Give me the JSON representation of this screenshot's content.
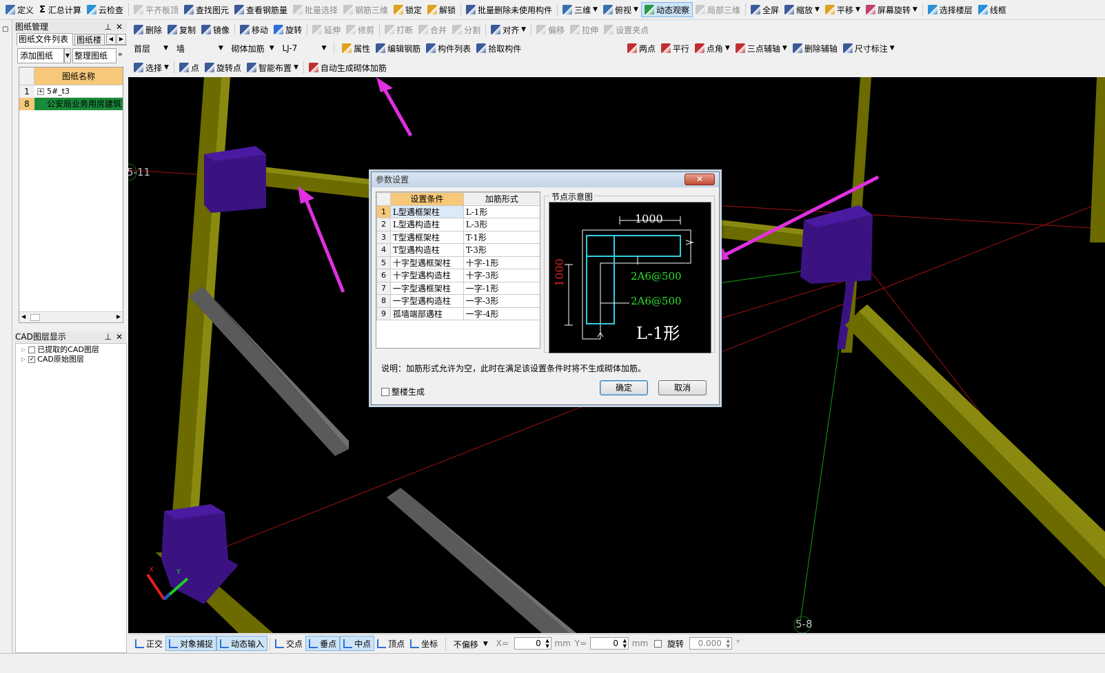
{
  "toolbar1": [
    {
      "label": "定义",
      "icon": "define-icon",
      "color": "#3a6fb0"
    },
    {
      "label": "汇总计算",
      "icon": "sigma-icon",
      "color": "#333333",
      "glyph": "Σ"
    },
    {
      "label": "云检查",
      "icon": "cloud-check-icon",
      "color": "#2c8fd8"
    },
    {
      "label": "平齐板顶",
      "icon": "align-top-icon",
      "color": "#a0a0a0",
      "disabled": true
    },
    {
      "label": "查找图元",
      "icon": "binoculars-icon",
      "color": "#3a5a9a"
    },
    {
      "label": "查看钢筋量",
      "icon": "rebar-view-icon",
      "color": "#3a5a9a"
    },
    {
      "label": "批量选择",
      "icon": "batch-select-icon",
      "color": "#a0a0a0",
      "disabled": true
    },
    {
      "label": "钢筋三维",
      "icon": "rebar-3d-icon",
      "color": "#a0a0a0",
      "disabled": true
    },
    {
      "label": "锁定",
      "icon": "lock-icon",
      "color": "#e0a020"
    },
    {
      "label": "解锁",
      "icon": "unlock-icon",
      "color": "#e0a020"
    },
    {
      "label": "批量删除未使用构件",
      "icon": "batch-delete-icon",
      "color": "#3a5a9a"
    },
    {
      "label": "三维",
      "icon": "cube-3d-icon",
      "color": "#3a6fb0",
      "dropdown": true
    },
    {
      "label": "俯视",
      "icon": "top-view-icon",
      "color": "#3a6fb0",
      "dropdown": true
    },
    {
      "label": "动态观察",
      "icon": "orbit-icon",
      "color": "#2a9a4a",
      "active": true
    },
    {
      "label": "局部三维",
      "icon": "local-3d-icon",
      "color": "#a0a0a0",
      "disabled": true
    },
    {
      "label": "全屏",
      "icon": "zoom-fit-icon",
      "color": "#3a5a9a"
    },
    {
      "label": "缩放",
      "icon": "zoom-icon",
      "color": "#3a5a9a",
      "dropdown": true
    },
    {
      "label": "平移",
      "icon": "pan-hand-icon",
      "color": "#e0a020",
      "dropdown": true
    },
    {
      "label": "屏幕旋转",
      "icon": "screen-rotate-icon",
      "color": "#c04070",
      "dropdown": true
    },
    {
      "label": "选择楼层",
      "icon": "floor-select-icon",
      "color": "#2c8fd8"
    },
    {
      "label": "线框",
      "icon": "wireframe-icon",
      "color": "#2c8fd8"
    }
  ],
  "toolbar2": [
    {
      "label": "删除",
      "icon": "delete-icon",
      "color": "#3a5a9a"
    },
    {
      "label": "复制",
      "icon": "copy-icon",
      "color": "#3a5a9a"
    },
    {
      "label": "镜像",
      "icon": "mirror-icon",
      "color": "#3a5a9a"
    },
    {
      "label": "移动",
      "icon": "move-icon",
      "color": "#3a5a9a"
    },
    {
      "label": "旋转",
      "icon": "rotate-icon",
      "color": "#2c6fd8"
    },
    {
      "label": "延伸",
      "icon": "extend-icon",
      "color": "#a0a0a0",
      "disabled": true
    },
    {
      "label": "修剪",
      "icon": "trim-icon",
      "color": "#a0a0a0",
      "disabled": true
    },
    {
      "label": "打断",
      "icon": "break-icon",
      "color": "#a0a0a0",
      "disabled": true
    },
    {
      "label": "合并",
      "icon": "merge-icon",
      "color": "#a0a0a0",
      "disabled": true
    },
    {
      "label": "分割",
      "icon": "split-icon",
      "color": "#a0a0a0",
      "disabled": true
    },
    {
      "label": "对齐",
      "icon": "align-icon",
      "color": "#3a5a9a",
      "dropdown": true
    },
    {
      "label": "偏移",
      "icon": "offset-icon",
      "color": "#a0a0a0",
      "disabled": true
    },
    {
      "label": "拉伸",
      "icon": "stretch-icon",
      "color": "#a0a0a0",
      "disabled": true
    },
    {
      "label": "设置夹点",
      "icon": "grip-icon",
      "color": "#a0a0a0",
      "disabled": true
    }
  ],
  "toolbar3": {
    "floor": "首层",
    "category": "墙",
    "component_type": "砌体加筋",
    "component": "LJ-7",
    "items": [
      {
        "label": "属性",
        "icon": "properties-icon",
        "color": "#e0a020"
      },
      {
        "label": "编辑钢筋",
        "icon": "edit-rebar-icon",
        "color": "#3a5a9a"
      },
      {
        "label": "构件列表",
        "icon": "component-list-icon",
        "color": "#3a5a9a"
      },
      {
        "label": "拾取构件",
        "icon": "pick-icon",
        "color": "#3a5a9a"
      }
    ],
    "axis_items": [
      {
        "label": "两点",
        "icon": "two-point-axis-icon",
        "color": "#c03030"
      },
      {
        "label": "平行",
        "icon": "parallel-axis-icon",
        "color": "#c03030"
      },
      {
        "label": "点角",
        "icon": "point-angle-axis-icon",
        "color": "#c03030",
        "dropdown": true
      },
      {
        "label": "三点辅轴",
        "icon": "three-point-axis-icon",
        "color": "#c03030",
        "dropdown": true
      },
      {
        "label": "删除辅轴",
        "icon": "delete-axis-icon",
        "color": "#3a5a9a"
      },
      {
        "label": "尺寸标注",
        "icon": "dimension-icon",
        "color": "#3a5a9a",
        "dropdown": true
      }
    ]
  },
  "toolbar4": [
    {
      "label": "选择",
      "icon": "cursor-icon",
      "color": "#3a5a9a",
      "dropdown": true
    },
    {
      "label": "点",
      "icon": "point-icon",
      "color": "#3a5a9a"
    },
    {
      "label": "旋转点",
      "icon": "rotate-point-icon",
      "color": "#3a5a9a"
    },
    {
      "label": "智能布置",
      "icon": "smart-layout-icon",
      "color": "#3a5a9a",
      "dropdown": true
    },
    {
      "label": "自动生成砌体加筋",
      "icon": "auto-generate-icon",
      "color": "#c03030"
    }
  ],
  "left_panel": {
    "title": "图纸管理",
    "tabs": [
      "图纸文件列表",
      "图纸楼层"
    ],
    "add_button": "添加图纸",
    "organize_button": "整理图纸",
    "column_header": "图纸名称",
    "rows": [
      {
        "num": "1",
        "name": "5#_t3",
        "expand": "+"
      },
      {
        "num": "8",
        "name": "公安局业务用房建筑"
      }
    ],
    "cad_title": "CAD图层显示",
    "cad_layers": [
      {
        "label": "已提取的CAD图层",
        "checked": false
      },
      {
        "label": "CAD原始图层",
        "checked": true
      }
    ]
  },
  "viewport": {
    "axis_labels": [
      "5-11",
      "5-8"
    ],
    "axis_x": "X",
    "axis_y": "Y"
  },
  "dialog": {
    "title": "参数设置",
    "close": "✕",
    "headers": [
      "设置条件",
      "加筋形式"
    ],
    "rows": [
      {
        "num": "1",
        "condition": "L型遇框架柱",
        "form": "L-1形"
      },
      {
        "num": "2",
        "condition": "L型遇构造柱",
        "form": "L-3形"
      },
      {
        "num": "3",
        "condition": "T型遇框架柱",
        "form": "T-1形"
      },
      {
        "num": "4",
        "condition": "T型遇构造柱",
        "form": "T-3形"
      },
      {
        "num": "5",
        "condition": "十字型遇框架柱",
        "form": "十字-1形"
      },
      {
        "num": "6",
        "condition": "十字型遇构造柱",
        "form": "十字-3形"
      },
      {
        "num": "7",
        "condition": "一字型遇框架柱",
        "form": "一字-1形"
      },
      {
        "num": "8",
        "condition": "一字型遇构造柱",
        "form": "一字-3形"
      },
      {
        "num": "9",
        "condition": "孤墙端部遇柱",
        "form": "一字-4形"
      }
    ],
    "preview_title": "节点示意图",
    "preview": {
      "dim_top": "1000",
      "dim_left": "1000",
      "rebar1": "2A6@500",
      "rebar2": "2A6@500",
      "shape": "L-1形"
    },
    "note": "说明：加筋形式允许为空，此时在满足该设置条件时将不生成砌体加筋。",
    "checkbox": "整楼生成",
    "ok": "确定",
    "cancel": "取消"
  },
  "statusbar": {
    "items": [
      {
        "label": "正交",
        "icon": "ortho-icon"
      },
      {
        "label": "对象捕捉",
        "icon": "snap-icon",
        "active": true
      },
      {
        "label": "动态输入",
        "icon": "dynamic-input-icon",
        "active": true
      },
      {
        "label": "交点",
        "icon": "intersect-icon"
      },
      {
        "label": "垂点",
        "icon": "perpendicular-icon",
        "active": true
      },
      {
        "label": "中点",
        "icon": "midpoint-icon",
        "active": true
      },
      {
        "label": "顶点",
        "icon": "vertex-icon"
      },
      {
        "label": "坐标",
        "icon": "coordinate-icon"
      }
    ],
    "offset_mode": "不偏移",
    "x_label": "X=",
    "x_value": "0",
    "y_label": "Y=",
    "y_value": "0",
    "unit": "mm",
    "rotate_label": "旋转",
    "rotate_value": "0.000",
    "degree": "°"
  },
  "colors": {
    "column": "#3a1380",
    "column_top": "#4a1aa0",
    "beam": "#6b6b00",
    "beam_light": "#8a8a10",
    "arrow": "#e030e0",
    "preview_cyan": "#30d0e0",
    "preview_green": "#30e030",
    "preview_red": "#e02020"
  }
}
